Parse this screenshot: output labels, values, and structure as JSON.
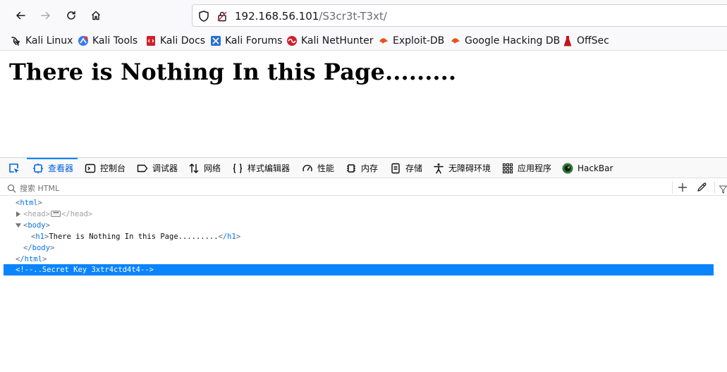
{
  "browser": {
    "url_host": "192.168.56.101",
    "url_path": "/S3cr3t-T3xt/"
  },
  "bookmarks": [
    {
      "label": "Kali Linux",
      "icon": "kali-dragon-icon"
    },
    {
      "label": "Kali Tools",
      "icon": "kali-tools-icon"
    },
    {
      "label": "Kali Docs",
      "icon": "kali-docs-icon"
    },
    {
      "label": "Kali Forums",
      "icon": "kali-forums-icon"
    },
    {
      "label": "Kali NetHunter",
      "icon": "kali-nethunter-icon"
    },
    {
      "label": "Exploit-DB",
      "icon": "exploit-db-icon"
    },
    {
      "label": "Google Hacking DB",
      "icon": "google-hacking-db-icon"
    },
    {
      "label": "OffSec",
      "icon": "offsec-icon"
    }
  ],
  "page": {
    "heading": "There is Nothing In this Page........."
  },
  "devtools": {
    "tabs": [
      {
        "label": "查看器",
        "icon": "inspector-icon",
        "selected": true
      },
      {
        "label": "控制台",
        "icon": "console-icon"
      },
      {
        "label": "调试器",
        "icon": "debugger-icon"
      },
      {
        "label": "网络",
        "icon": "network-icon"
      },
      {
        "label": "样式编辑器",
        "icon": "style-editor-icon"
      },
      {
        "label": "性能",
        "icon": "performance-icon"
      },
      {
        "label": "内存",
        "icon": "memory-icon"
      },
      {
        "label": "存储",
        "icon": "storage-icon"
      },
      {
        "label": "无障碍环境",
        "icon": "accessibility-icon"
      },
      {
        "label": "应用程序",
        "icon": "application-icon"
      },
      {
        "label": "HackBar",
        "icon": "hackbar-icon"
      }
    ],
    "search_placeholder": "搜索 HTML",
    "markup": {
      "html_open": "html",
      "head_tag": "head",
      "head_close": "/head",
      "body_open": "body",
      "h1_open": "h1",
      "h1_text": "There is Nothing In this Page.........",
      "h1_close": "/h1",
      "body_close": "/body",
      "html_close": "/html",
      "comment": "<!--..Secret Key 3xtr4ctd4t4-->"
    }
  },
  "colors": {
    "accent": "#0a84ff",
    "tag": "#0074e8",
    "selected_tab_text": "#0061e0"
  }
}
